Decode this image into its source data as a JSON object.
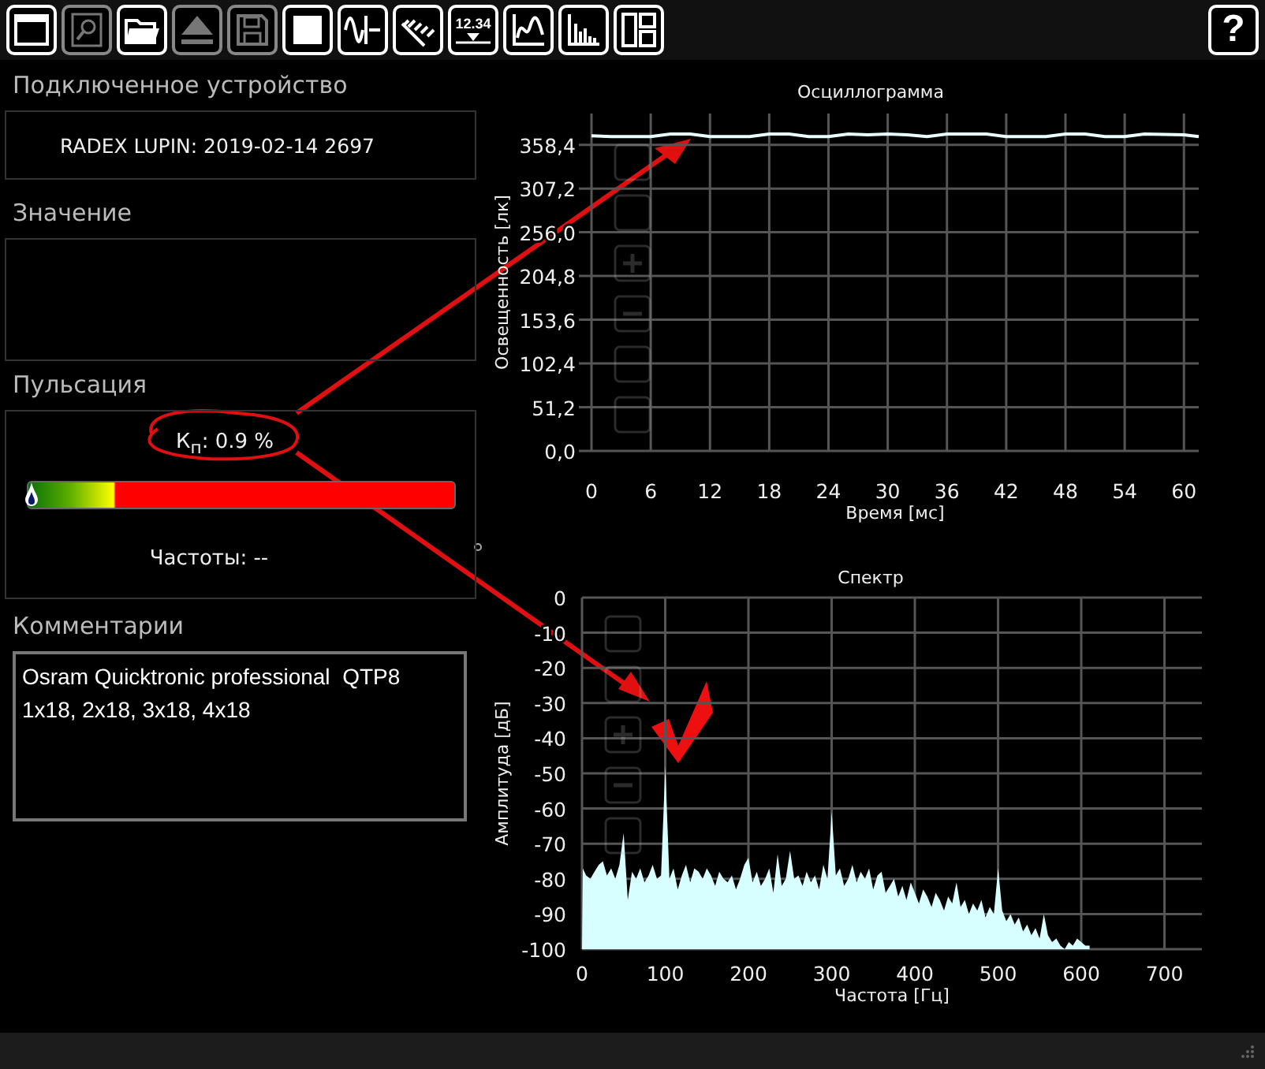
{
  "toolbar": {
    "buttons": [
      {
        "kind": "window",
        "disabled": false
      },
      {
        "kind": "search",
        "disabled": true
      },
      {
        "kind": "folder",
        "disabled": false
      },
      {
        "kind": "eject",
        "disabled": true
      },
      {
        "kind": "save",
        "disabled": true
      },
      {
        "kind": "stop",
        "disabled": false
      },
      {
        "kind": "scope",
        "disabled": false
      },
      {
        "kind": "probe",
        "disabled": false
      },
      {
        "kind": "value",
        "label": "12.34",
        "disabled": false
      },
      {
        "kind": "wave",
        "disabled": false
      },
      {
        "kind": "spectrum",
        "disabled": false
      },
      {
        "kind": "layout",
        "disabled": false
      }
    ],
    "help": "?"
  },
  "device": {
    "heading": "Подключенное устройство",
    "value": "RADEX LUPIN: 2019-02-14 2697"
  },
  "value": {
    "heading": "Значение"
  },
  "pulsation": {
    "heading": "Пульсация",
    "coefficient": "К$_{п}$: 0.9 %",
    "level": 0.01,
    "frequencies": "Частоты: --"
  },
  "comments": {
    "heading": "Комментарии",
    "text": "Osram Quicktronic professional  QTP8\n1x18, 2x18, 3x18, 4x18"
  },
  "oscillogram": {
    "chart_data": {
      "type": "line",
      "title": "Осциллограмма",
      "xlabel": "Время [мс]",
      "ylabel": "Освещенность [лк]",
      "x": [
        0,
        2,
        4,
        6,
        8,
        10,
        12,
        14,
        16,
        18,
        20,
        22,
        24,
        26,
        28,
        30,
        32,
        34,
        36,
        38,
        40,
        42,
        44,
        46,
        48,
        50,
        52,
        54,
        56,
        60,
        61.5
      ],
      "grid": true,
      "series": [
        {
          "color": "#e8ffff",
          "values": [
            369,
            368,
            368,
            368,
            371,
            371,
            368,
            368,
            368,
            371,
            371,
            368,
            368,
            371,
            370,
            371,
            370,
            368,
            371,
            371,
            371,
            368,
            368,
            368,
            371,
            371,
            368,
            368,
            371,
            370,
            368
          ]
        }
      ],
      "xlim": [
        0,
        61.5
      ],
      "ylim": [
        0,
        395
      ],
      "xticks": [
        0,
        6,
        12,
        18,
        24,
        30,
        36,
        42,
        48,
        54,
        60
      ],
      "yticks": [
        {
          "value": 0,
          "label": "0,0"
        },
        {
          "value": 51.2,
          "label": "51,2"
        },
        {
          "value": 102.4,
          "label": "102,4"
        },
        {
          "value": 153.6,
          "label": "153,6"
        },
        {
          "value": 204.8,
          "label": "204,8"
        },
        {
          "value": 256,
          "label": "256,0"
        },
        {
          "value": 307.2,
          "label": "307,2"
        },
        {
          "value": 358.4,
          "label": "358,4"
        }
      ]
    }
  },
  "spectrum": {
    "chart_data": {
      "type": "area",
      "grid": true,
      "title": "Спектр",
      "xlabel": "Частота [Гц]",
      "ylabel": "Амплитуда [дБ]",
      "x": [
        0,
        1,
        5,
        10,
        15,
        20,
        25,
        30,
        35,
        40,
        45,
        50,
        55,
        60,
        65,
        70,
        75,
        80,
        85,
        90,
        95,
        100,
        105,
        110,
        115,
        120,
        125,
        130,
        135,
        140,
        145,
        150,
        155,
        160,
        165,
        170,
        175,
        180,
        185,
        190,
        195,
        200,
        205,
        210,
        215,
        220,
        225,
        230,
        235,
        240,
        245,
        250,
        255,
        260,
        265,
        270,
        275,
        280,
        285,
        290,
        295,
        300,
        305,
        310,
        315,
        320,
        325,
        330,
        335,
        340,
        345,
        350,
        355,
        360,
        365,
        370,
        375,
        380,
        385,
        390,
        395,
        400,
        405,
        410,
        415,
        420,
        425,
        430,
        435,
        440,
        445,
        450,
        455,
        460,
        465,
        470,
        475,
        480,
        485,
        490,
        495,
        500,
        505,
        510,
        515,
        520,
        525,
        530,
        535,
        540,
        545,
        550,
        555,
        560,
        565,
        570,
        575,
        580,
        585,
        590,
        595,
        600,
        605,
        610
      ],
      "series": [
        {
          "color": "#d8ffff",
          "values": [
            -100,
            -77,
            -79,
            -80,
            -78,
            -76,
            -75,
            -79,
            -77,
            -80,
            -76,
            -67,
            -86,
            -78,
            -80,
            -77,
            -81,
            -79,
            -76,
            -80,
            -79,
            -48,
            -80,
            -77,
            -83,
            -79,
            -76,
            -81,
            -77,
            -78,
            -80,
            -77,
            -79,
            -82,
            -78,
            -80,
            -81,
            -79,
            -83,
            -80,
            -76,
            -74,
            -81,
            -78,
            -82,
            -80,
            -77,
            -84,
            -73,
            -82,
            -80,
            -72,
            -80,
            -79,
            -82,
            -78,
            -81,
            -79,
            -83,
            -76,
            -80,
            -61,
            -79,
            -77,
            -82,
            -80,
            -76,
            -81,
            -78,
            -80,
            -77,
            -83,
            -79,
            -78,
            -84,
            -82,
            -80,
            -85,
            -82,
            -86,
            -81,
            -84,
            -87,
            -83,
            -85,
            -88,
            -84,
            -86,
            -89,
            -85,
            -87,
            -81,
            -88,
            -86,
            -90,
            -87,
            -89,
            -86,
            -91,
            -88,
            -90,
            -77,
            -89,
            -92,
            -90,
            -93,
            -91,
            -95,
            -93,
            -96,
            -94,
            -97,
            -90,
            -96,
            -98,
            -97,
            -99,
            -100,
            -98,
            -99,
            -97,
            -98,
            -99,
            -99
          ]
        }
      ],
      "xlim": [
        0,
        745
      ],
      "ylim": [
        -100,
        0
      ],
      "xticks": [
        0,
        100,
        200,
        300,
        400,
        500,
        600,
        700
      ],
      "yticks": [
        0,
        -10,
        -20,
        -30,
        -40,
        -50,
        -60,
        -70,
        -80,
        -90,
        -100
      ]
    }
  }
}
